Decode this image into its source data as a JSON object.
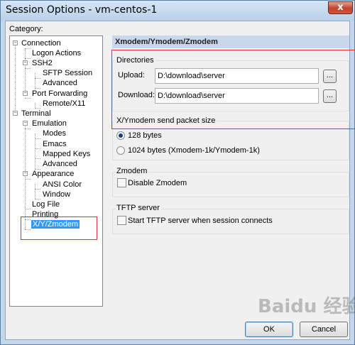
{
  "window": {
    "title": "Session Options - vm-centos-1",
    "close_label": "x"
  },
  "category": {
    "label": "Category:",
    "tree": {
      "connection": "Connection",
      "logon_actions": "Logon Actions",
      "ssh2": "SSH2",
      "sftp_session": "SFTP Session",
      "advanced": "Advanced",
      "port_forwarding": "Port Forwarding",
      "remote_x11": "Remote/X11",
      "terminal": "Terminal",
      "emulation": "Emulation",
      "modes": "Modes",
      "emacs": "Emacs",
      "mapped_keys": "Mapped Keys",
      "advanced2": "Advanced",
      "appearance": "Appearance",
      "ansi_color": "ANSI Color",
      "window": "Window",
      "log_file": "Log File",
      "printing": "Printing",
      "xyzmodem": "X/Y/Zmodem"
    }
  },
  "panel": {
    "header": "Xmodem/Ymodem/Zmodem",
    "directories": {
      "title": "Directories",
      "upload_label": "Upload:",
      "upload_value": "D:\\download\\server",
      "download_label": "Download:",
      "download_value": "D:\\download\\server",
      "browse_label": "..."
    },
    "packet_size": {
      "title": "X/Ymodem send packet size",
      "opt128": "128 bytes",
      "opt1024": "1024 bytes  (Xmodem-1k/Ymodem-1k)",
      "selected": "128 bytes"
    },
    "zmodem": {
      "title": "Zmodem",
      "disable_label": "Disable Zmodem"
    },
    "tftp": {
      "title": "TFTP server",
      "start_label": "Start TFTP server when session connects"
    }
  },
  "buttons": {
    "ok": "OK",
    "cancel": "Cancel"
  },
  "watermark": "Baidu 经验",
  "colors": {
    "selection": "#3399ff",
    "highlight_box": "#e03030",
    "header_bg": "#c8d8ea"
  }
}
